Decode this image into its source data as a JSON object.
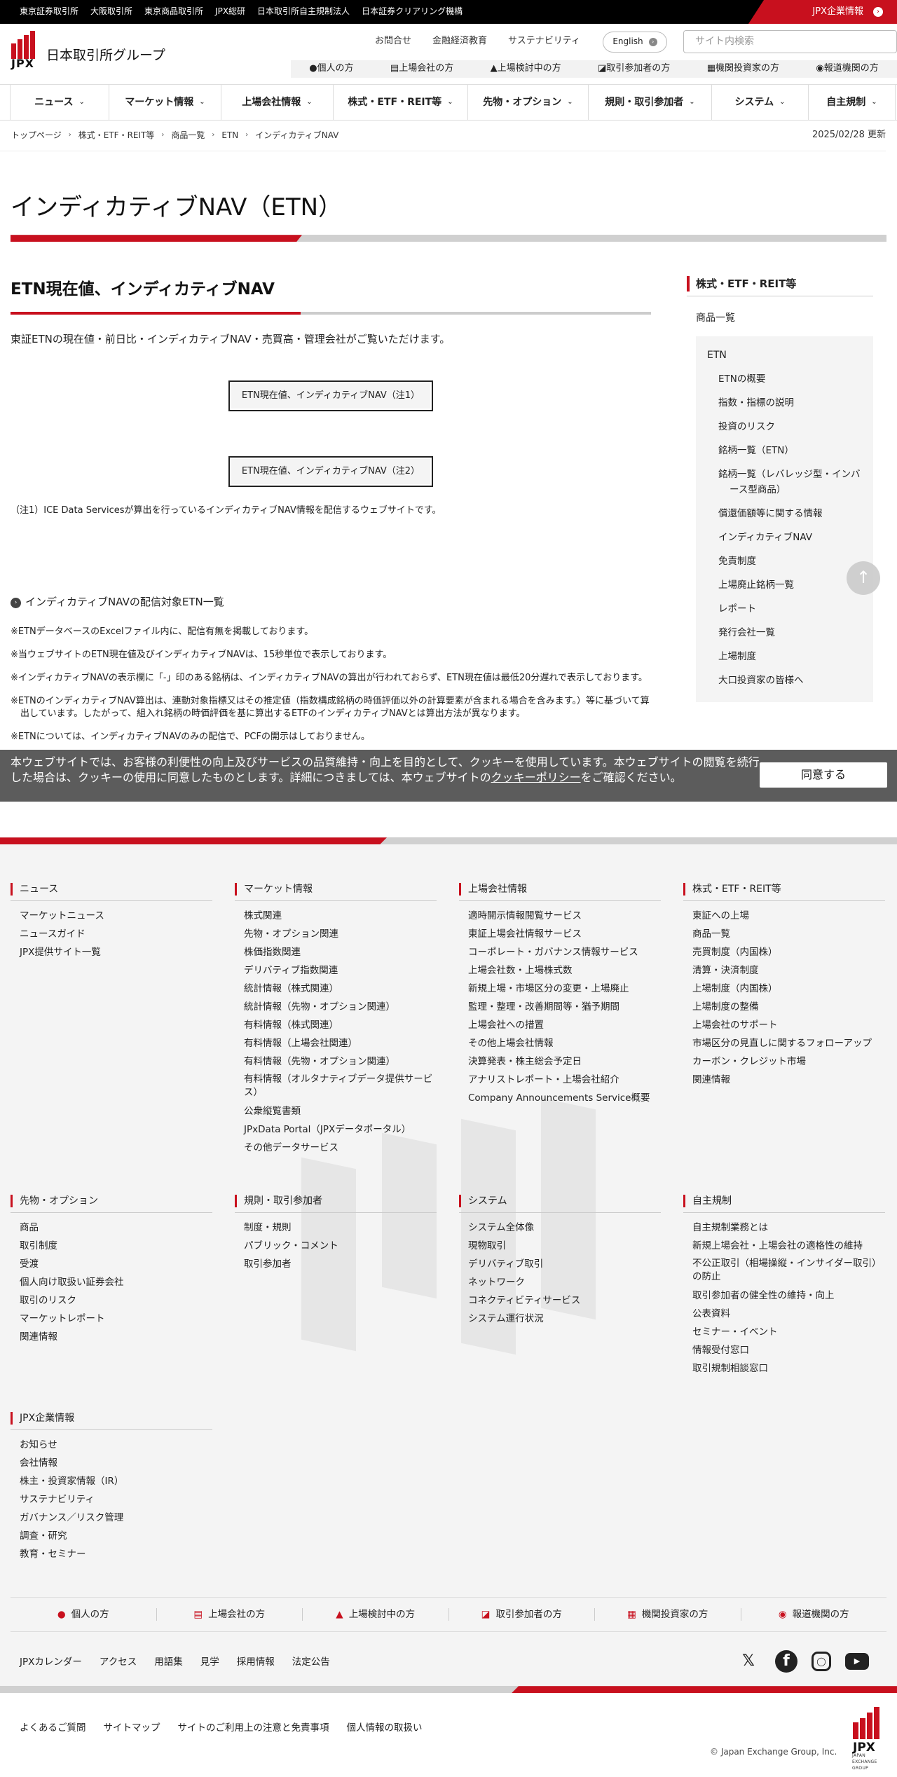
{
  "topbar": {
    "links": [
      "東京証券取引所",
      "大阪取引所",
      "東京商品取引所",
      "JPX総研",
      "日本取引所自主規制法人",
      "日本証券クリアリング機構"
    ],
    "corporate": "JPX企業情報"
  },
  "header": {
    "logo_text": "JPX",
    "site_name": "日本取引所グループ",
    "links": [
      "お問合せ",
      "金融経済教育",
      "サステナビリティ"
    ],
    "language": "English",
    "search_placeholder": "サイト内検索",
    "audience": [
      "個人の方",
      "上場会社の方",
      "上場検討中の方",
      "取引参加者の方",
      "機関投資家の方",
      "報道機関の方"
    ]
  },
  "gnav": [
    "ニュース",
    "マーケット情報",
    "上場会社情報",
    "株式・ETF・REIT等",
    "先物・オプション",
    "規則・取引参加者",
    "システム",
    "自主規制"
  ],
  "breadcrumb": {
    "items": [
      "トップページ",
      "株式・ETF・REIT等",
      "商品一覧",
      "ETN",
      "インディカティブNAV"
    ],
    "updated": "2025/02/28 更新"
  },
  "page": {
    "title": "インディカティブNAV（ETN）",
    "section_title": "ETN現在値、インディカティブNAV",
    "intro": "東証ETNの現在値・前日比・インディカティブNAV・売買高・管理会社がご覧いただけます。",
    "button1": "ETN現在値、インディカティブNAV（注1）",
    "button2": "ETN現在値、インディカティブNAV（注2）",
    "note1": "（注1）ICE Data Servicesが算出を行っているインディカティブNAV情報を配信するウェブサイトです。",
    "list_link": "インディカティブNAVの配信対象ETN一覧",
    "notes": [
      "※ETNデータベースのExcelファイル内に、配信有無を掲載しております。",
      "※当ウェブサイトのETN現在値及びインディカティブNAVは、15秒単位で表示しております。",
      "※インディカティブNAVの表示欄に「-」印のある銘柄は、インディカティブNAVの算出が行われておらず、ETN現在値は最低20分遅れで表示しております。",
      "※ETNのインディカティブNAV算出は、連動対象指標又はその推定値（指数構成銘柄の時価評価以外の計算要素が含まれる場合を含みます。）等に基づいて算出しています。したがって、組入れ銘柄の時価評価を基に算出するETFのインディカティブNAVとは算出方法が異なります。",
      "※ETNについては、インディカティブNAVのみの配信で、PCFの開示はしておりません。"
    ]
  },
  "sidebar": {
    "heading": "株式・ETF・REIT等",
    "level1": "商品一覧",
    "level2": "ETN",
    "items": [
      "ETNの概要",
      "指数・指標の説明",
      "投資のリスク",
      "銘柄一覧（ETN）",
      "銘柄一覧（レバレッジ型・インバース型商品）",
      "償還価額等に関する情報",
      "インディカティブNAV",
      "免責制度",
      "上場廃止銘柄一覧",
      "レポート",
      "発行会社一覧",
      "上場制度",
      "大口投資家の皆様へ"
    ]
  },
  "cookie": {
    "text_before": "本ウェブサイトでは、お客様の利便性の向上及びサービスの品質維持・向上を目的として、クッキーを使用しています。本ウェブサイトの閲覧を続行した場合は、クッキーの使用に同意したものとします。詳細につきましては、本ウェブサイトの",
    "link": "クッキーポリシー",
    "text_after": "をご確認ください。",
    "accept": "同意する"
  },
  "footer": {
    "columns": [
      {
        "title": "ニュース",
        "items": [
          "マーケットニュース",
          "ニュースガイド",
          "JPX提供サイト一覧"
        ]
      },
      {
        "title": "マーケット情報",
        "items": [
          "株式関連",
          "先物・オプション関連",
          "株価指数関連",
          "デリバティブ指数関連",
          "統計情報（株式関連）",
          "統計情報（先物・オプション関連）",
          "有料情報（株式関連）",
          "有料情報（上場会社関連）",
          "有料情報（先物・オプション関連）",
          "有料情報（オルタナティブデータ提供サービス）",
          "公衆縦覧書類",
          "JPxData Portal（JPXデータポータル）",
          "その他データサービス"
        ]
      },
      {
        "title": "上場会社情報",
        "items": [
          "適時開示情報閲覧サービス",
          "東証上場会社情報サービス",
          "コーポレート・ガバナンス情報サービス",
          "上場会社数・上場株式数",
          "新規上場・市場区分の変更・上場廃止",
          "監理・整理・改善期間等・猶予期間",
          "上場会社への措置",
          "その他上場会社情報",
          "決算発表・株主総会予定日",
          "アナリストレポート・上場会社紹介",
          "Company Announcements Service概要"
        ]
      },
      {
        "title": "株式・ETF・REIT等",
        "items": [
          "東証への上場",
          "商品一覧",
          "売買制度（内国株）",
          "清算・決済制度",
          "上場制度（内国株）",
          "上場制度の整備",
          "上場会社のサポート",
          "市場区分の見直しに関するフォローアップ",
          "カーボン・クレジット市場",
          "関連情報"
        ]
      },
      {
        "title": "先物・オプション",
        "items": [
          "商品",
          "取引制度",
          "受渡",
          "個人向け取扱い証券会社",
          "取引のリスク",
          "マーケットレポート",
          "関連情報"
        ]
      },
      {
        "title": "規則・取引参加者",
        "items": [
          "制度・規則",
          "パブリック・コメント",
          "取引参加者"
        ]
      },
      {
        "title": "システム",
        "items": [
          "システム全体像",
          "現物取引",
          "デリバティブ取引",
          "ネットワーク",
          "コネクティビティサービス",
          "システム運行状況"
        ]
      },
      {
        "title": "自主規制",
        "items": [
          "自主規制業務とは",
          "新規上場会社・上場会社の適格性の維持",
          "不公正取引（相場操縦・インサイダー取引）の防止",
          "取引参加者の健全性の維持・向上",
          "公表資料",
          "セミナー・イベント",
          "情報受付窓口",
          "取引規制相談窓口"
        ]
      },
      {
        "title": "JPX企業情報",
        "items": [
          "お知らせ",
          "会社情報",
          "株主・投資家情報（IR）",
          "サステナビリティ",
          "ガバナンス／リスク管理",
          "調査・研究",
          "教育・セミナー"
        ]
      }
    ],
    "audience": [
      "個人の方",
      "上場会社の方",
      "上場検討中の方",
      "取引参加者の方",
      "機関投資家の方",
      "報道機関の方"
    ],
    "misc": [
      "JPXカレンダー",
      "アクセス",
      "用語集",
      "見学",
      "採用情報",
      "法定公告"
    ],
    "bottom": [
      "よくあるご質問",
      "サイトマップ",
      "サイトのご利用上の注意と免責事項",
      "個人情報の取扱い"
    ],
    "copyright": "© Japan Exchange Group, Inc.",
    "logo_text": "JPX",
    "logo_sub": "JAPAN EXCHANGE GROUP"
  },
  "colors": {
    "brand_red": "#c8101e"
  }
}
